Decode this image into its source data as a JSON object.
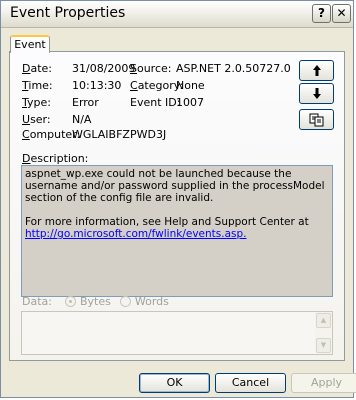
{
  "window": {
    "title": "Event Properties",
    "help_label": "?",
    "close_label": "✕"
  },
  "tabs": [
    {
      "label": "Event"
    }
  ],
  "event": {
    "date_label": "Date:",
    "date_value": "31/08/2009",
    "time_label": "Time:",
    "time_value": "10:13:30",
    "type_label": "Type:",
    "type_value": "Error",
    "user_label": "User:",
    "user_value": "N/A",
    "computer_label": "Computer:",
    "computer_value": "WGLAIBFZPWD3J",
    "source_label": "Source:",
    "source_value": "ASP.NET 2.0.50727.0",
    "category_label": "Category:",
    "category_value": "None",
    "event_id_label": "Event ID:",
    "event_id_value": "1007"
  },
  "side_buttons": {
    "up_icon": "arrow-up-icon",
    "down_icon": "arrow-down-icon",
    "copy_icon": "copy-icon"
  },
  "description": {
    "label": "Description:",
    "paragraph1": "aspnet_wp.exe could not be launched because the username and/or password supplied in the processModel section of the config file are invalid.",
    "paragraph2": "For more information, see Help and Support Center at",
    "link": "http://go.microsoft.com/fwlink/events.asp."
  },
  "data": {
    "label": "Data:",
    "bytes_label": "Bytes",
    "words_label": "Words",
    "selected": "Bytes"
  },
  "buttons": {
    "ok": "OK",
    "cancel": "Cancel",
    "apply": "Apply"
  },
  "colors": {
    "link": "#0000ff",
    "tab_accent": "#ffc83c",
    "description_bg": "#d4d0c8"
  }
}
